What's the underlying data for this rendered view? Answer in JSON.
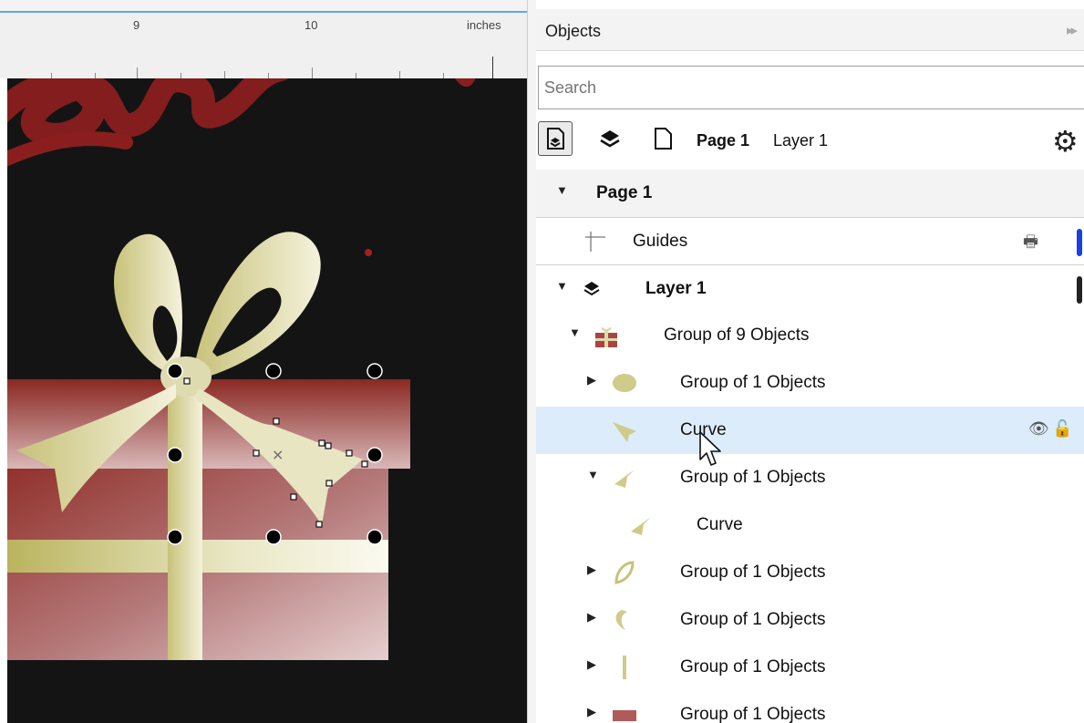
{
  "ruler": {
    "labels": [
      "9",
      "10",
      "inches"
    ]
  },
  "panel": {
    "title": "Objects",
    "collapse_icon": "collapse-panel-icon",
    "search": {
      "value": "Search",
      "placeholder": "Search"
    },
    "toolbar": {
      "buttons": [
        "page-layers-icon",
        "layer-icon",
        "page-icon"
      ],
      "current_page": "Page 1",
      "current_layer": "Layer 1",
      "settings_icon": "gear-icon"
    }
  },
  "tree": {
    "page": {
      "label": "Page 1"
    },
    "guides": {
      "label": "Guides",
      "color": "#1a3fe6"
    },
    "layer": {
      "label": "Layer 1",
      "color": "#222222"
    },
    "group9": {
      "label": "Group of 9 Objects"
    },
    "items": [
      {
        "label": "Group of 1 Objects"
      },
      {
        "label": "Curve"
      },
      {
        "label": "Group of 1 Objects"
      },
      {
        "label": "Curve"
      },
      {
        "label": "Group of 1 Objects"
      },
      {
        "label": "Group of 1 Objects"
      },
      {
        "label": "Group of 1 Objects"
      },
      {
        "label": "Group of 1 Objects"
      }
    ]
  },
  "colors": {
    "accent": "#5aaae8",
    "selection": "#dcecfb",
    "canvas_bg": "#141414",
    "ribbon": "#d9d59c",
    "box": "#9a3a32",
    "script_text": "#8a1e1e"
  }
}
